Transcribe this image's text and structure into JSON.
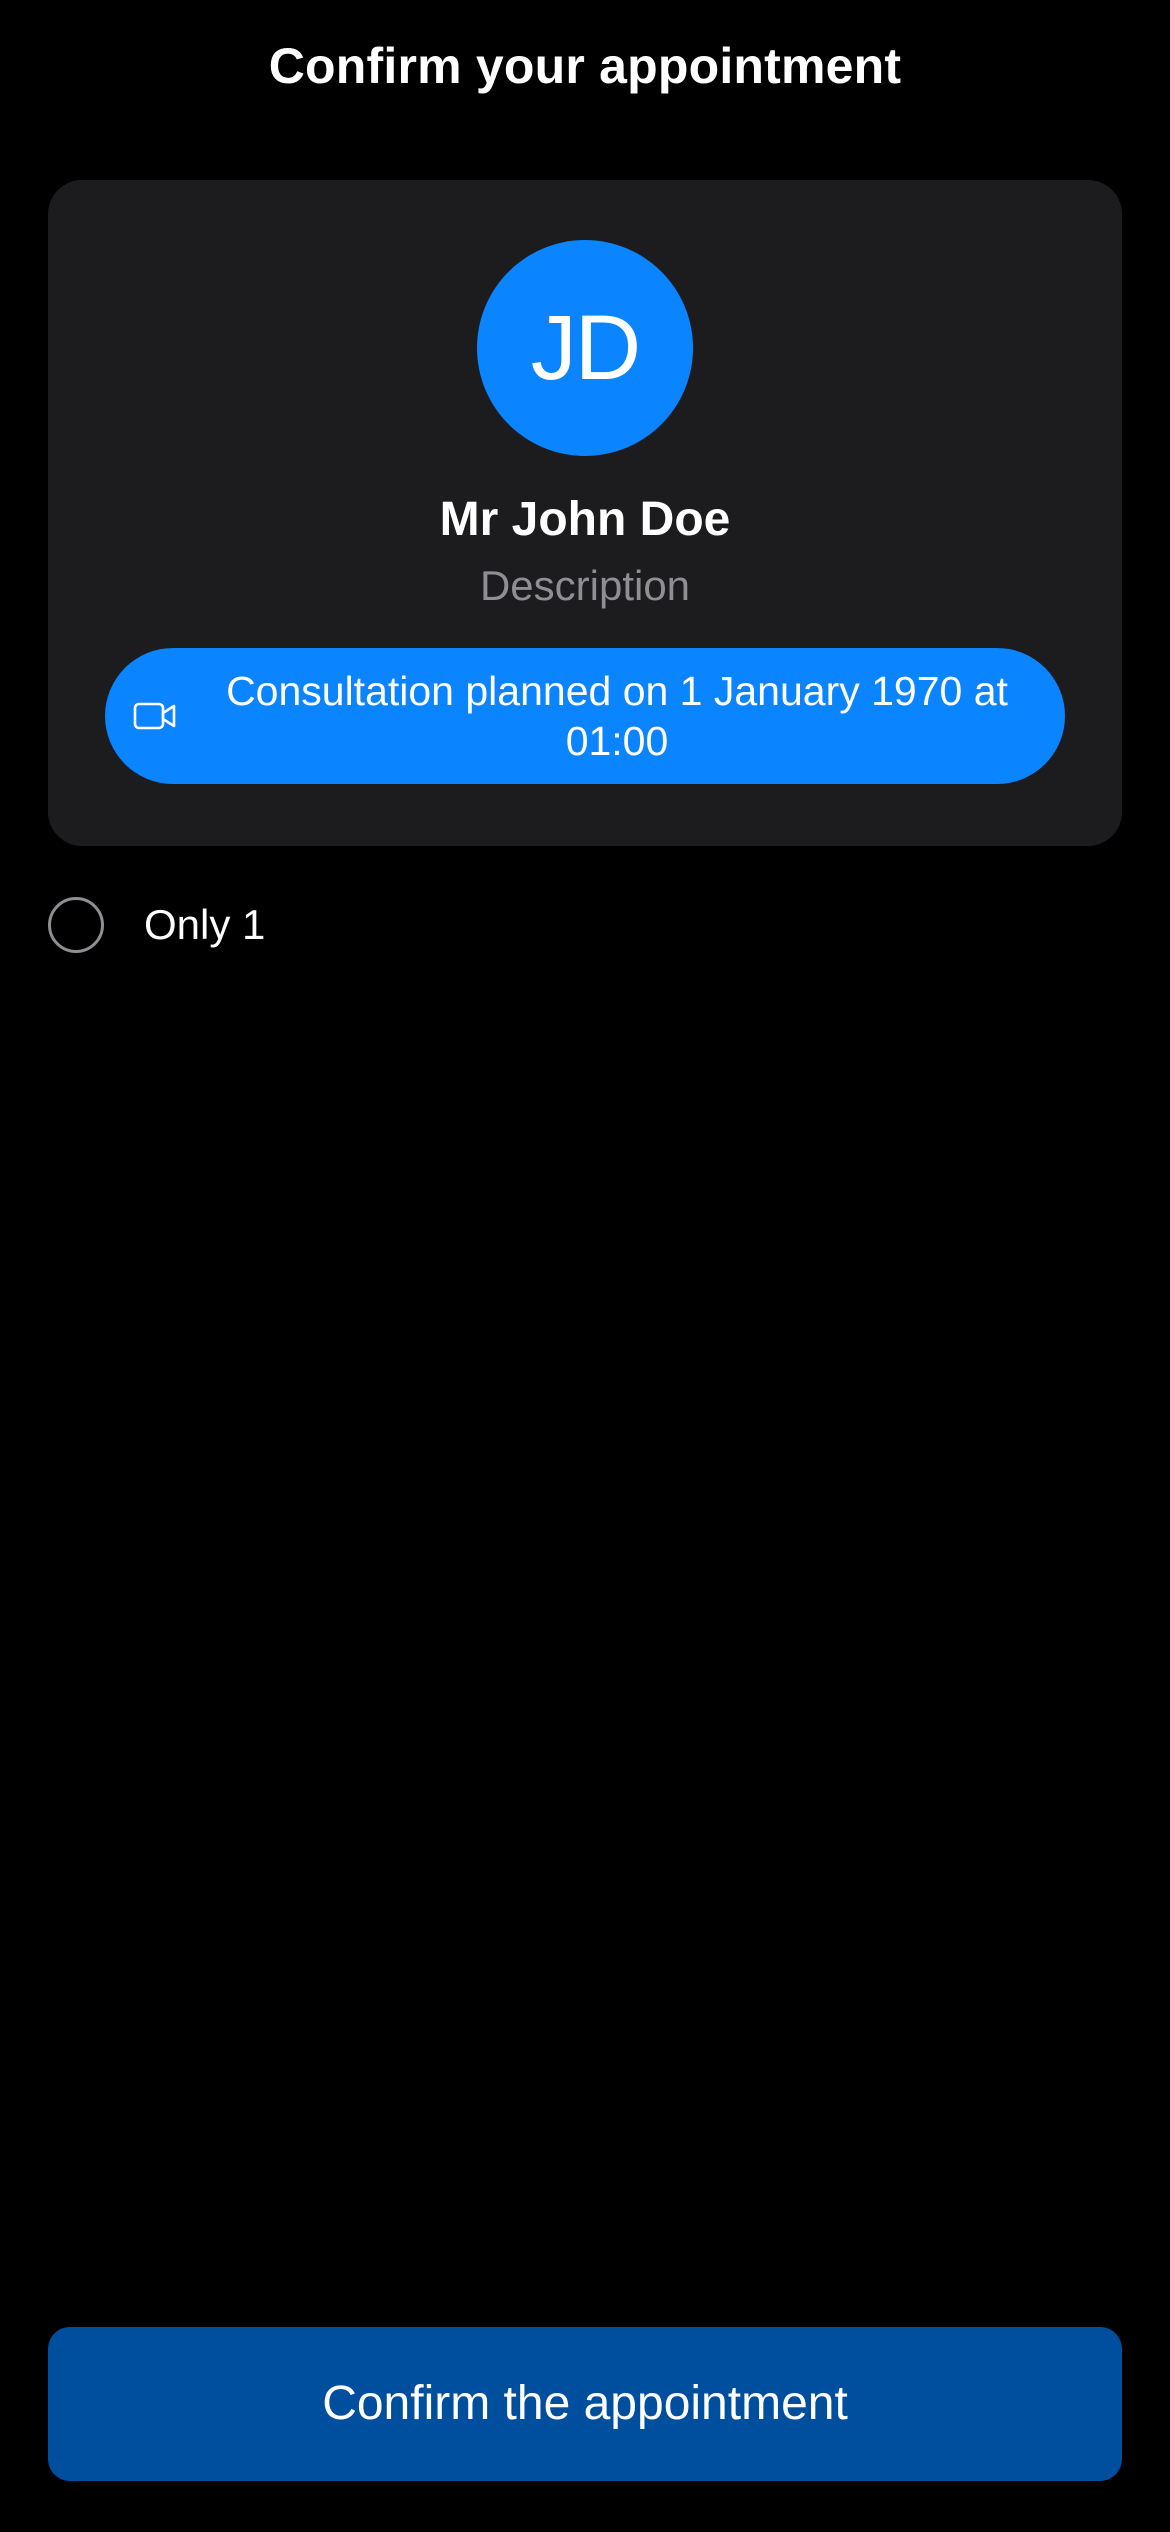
{
  "header": {
    "title": "Confirm your appointment"
  },
  "doctor_card": {
    "avatar_initials": "JD",
    "name": "Mr John Doe",
    "description": "Description",
    "consultation": {
      "icon": "video-camera-icon",
      "text": "Consultation planned on 1 January 1970 at 01:00"
    }
  },
  "options": [
    {
      "label": "Only 1",
      "selected": false
    }
  ],
  "footer": {
    "confirm_label": "Confirm the appointment"
  },
  "colors": {
    "background": "#000000",
    "card": "#1c1c1e",
    "accent": "#0a84ff",
    "button": "#004f9e",
    "secondary_text": "#8e8e93"
  }
}
